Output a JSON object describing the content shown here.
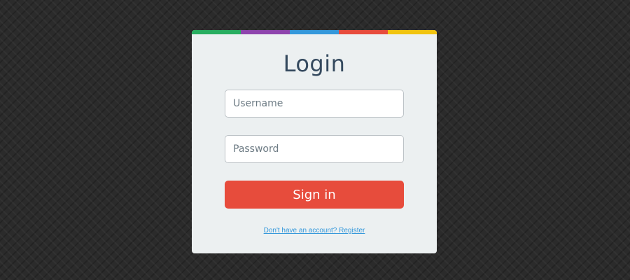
{
  "page": {
    "background_color": "#2b2b2b"
  },
  "login": {
    "title": "Login",
    "username": {
      "placeholder": "Username",
      "value": ""
    },
    "password": {
      "placeholder": "Password",
      "value": ""
    },
    "signin_label": "Sign in",
    "register_link": "Don't have an account? Register",
    "card_color": "#ecf0f1",
    "title_color": "#34495e",
    "button_color": "#e74c3c",
    "link_color": "#3498db",
    "accent_stripe_colors": [
      "#27ae60",
      "#8e44ad",
      "#3498db",
      "#e74c3c",
      "#f1c40f"
    ]
  }
}
